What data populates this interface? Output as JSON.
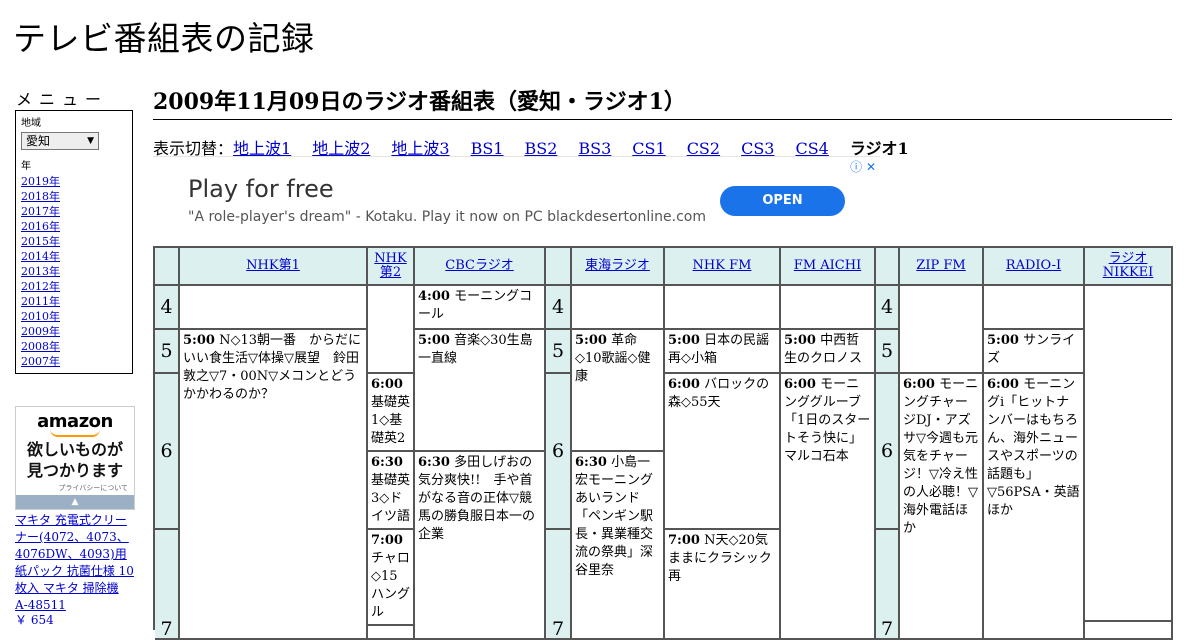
{
  "site_title": "テレビ番組表の記録",
  "menu": {
    "title": "メニュー",
    "region_label": "地域",
    "region_value": "愛知",
    "year_label": "年",
    "years": [
      "2019年",
      "2018年",
      "2017年",
      "2016年",
      "2015年",
      "2014年",
      "2013年",
      "2012年",
      "2011年",
      "2010年",
      "2009年",
      "2008年",
      "2007年"
    ]
  },
  "amazon_ad": {
    "logo": "amazon",
    "tagline_1": "欲しいものが",
    "tagline_2": "見つかります",
    "privacy": "プライバシーについて",
    "product": "マキタ 充電式クリーナー(4072、4073、4076DW、4093)用 紙パック 抗菌仕様 10枚入 マキタ 掃除機 A-48511",
    "price": "￥ 654"
  },
  "page_heading": "2009年11月09日のラジオ番組表（愛知・ラジオ1）",
  "switcher": {
    "label": "表示切替：",
    "links": [
      "地上波1",
      "地上波2",
      "地上波3",
      "BS1",
      "BS2",
      "BS3",
      "CS1",
      "CS2",
      "CS3",
      "CS4"
    ],
    "current": "ラジオ1"
  },
  "ad_banner": {
    "headline": "Play for free",
    "description": "\"A role-player's dream\" - Kotaku. Play it now on PC blackdesertonline.com",
    "button": "OPEN",
    "info": "ⓘ ✕"
  },
  "stations": [
    "NHK第1",
    "NHK第2",
    "CBCラジオ",
    "東海ラジオ",
    "NHK FM",
    "FM AICHI",
    "ZIP FM",
    "RADIO-I",
    "ラジオNIKKEI"
  ],
  "hours": [
    "4",
    "5",
    "6",
    "7"
  ],
  "programs": {
    "nhk1_500_time": "5:00",
    "nhk1_500_title": "N◇13朝一番　からだにいい食生活▽体操▽展望　鈴田敦之▽7・00N▽メコンとどうかかわるのか？",
    "nhk2_600_time": "6:00",
    "nhk2_600_title": "基礎英1◇基礎英2",
    "nhk2_630_time": "6:30",
    "nhk2_630_title": "基礎英3◇ドイツ語",
    "nhk2_700_time": "7:00",
    "nhk2_700_title": "チャロ◇15ハングル",
    "cbc_400_time": "4:00",
    "cbc_400_title": "モーニングコール",
    "cbc_500_time": "5:00",
    "cbc_500_title": "音楽◇30生島一直線",
    "cbc_630_time": "6:30",
    "cbc_630_title": "多田しげおの気分爽快!!　手や首がなる音の正体▽競馬の勝負服日本一の企業",
    "tokai_500_time": "5:00",
    "tokai_500_title": "革命◇10歌謡◇健康",
    "tokai_630_time": "6:30",
    "tokai_630_title": "小島一宏モーニングあいランド「ペンギン駅長・異業種交流の祭典」深谷里奈",
    "nhkfm_500_time": "5:00",
    "nhkfm_500_title": "日本の民謡再◇小箱",
    "nhkfm_600_time": "6:00",
    "nhkfm_600_title": "バロックの森◇55天",
    "nhkfm_700_time": "7:00",
    "nhkfm_700_title": "N天◇20気ままにクラシック再",
    "fma_500_time": "5:00",
    "fma_500_title": "中西哲生のクロノス",
    "fma_600_time": "6:00",
    "fma_600_title": "モーニンググルーブ「1日のスタートそう快に」マルコ石本",
    "zip_600_time": "6:00",
    "zip_600_title": "モーニングチャージDJ・アズサ▽今週も元気をチャージ！▽冷え性の人必聴！▽海外電話ほか",
    "radioi_500_time": "5:00",
    "radioi_500_title": "サンライズ",
    "radioi_600_time": "6:00",
    "radioi_600_title": "モーニングi「ヒットナンバーはもちろん、海外ニュースやスポーツの話題も」▽56PSA・英語ほか"
  }
}
